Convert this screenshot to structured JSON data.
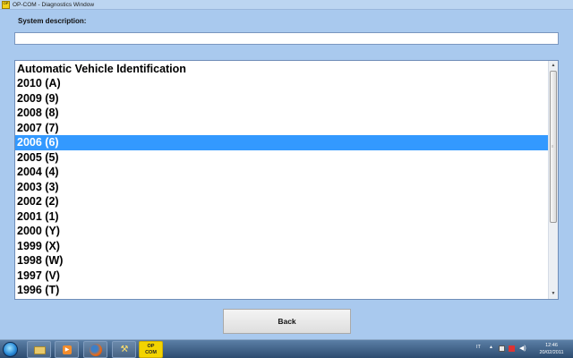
{
  "window": {
    "title": "OP-COM - Diagnostics Window",
    "app_icon_text": "OP"
  },
  "system_description": {
    "label": "System description:",
    "value": ""
  },
  "list": {
    "header": "Automatic Vehicle Identification",
    "items": [
      "2010 (A)",
      "2009 (9)",
      "2008 (8)",
      "2007 (7)",
      "2006 (6)",
      "2005 (5)",
      "2004 (4)",
      "2003 (3)",
      "2002 (2)",
      "2001 (1)",
      "2000 (Y)",
      "1999 (X)",
      "1998 (W)",
      "1997 (V)",
      "1996 (T)"
    ],
    "selected_index": 4
  },
  "back_button": {
    "label": "Back"
  },
  "taskbar": {
    "opcom_label_line1": "OP",
    "opcom_label_line2": "COM",
    "language": "IT",
    "time": "12:46",
    "date": "20/02/2011"
  },
  "colors": {
    "selection": "#3399ff",
    "background": "#a9c9ee"
  }
}
